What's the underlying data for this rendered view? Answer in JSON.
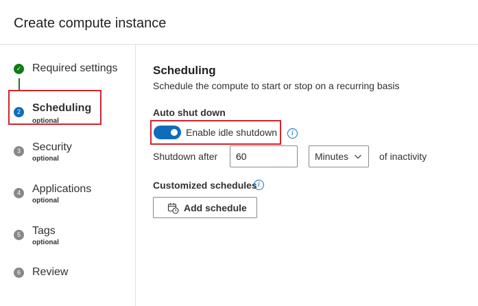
{
  "header": {
    "title": "Create compute instance"
  },
  "steps": [
    {
      "number": "✓",
      "label": "Required settings",
      "sub": "",
      "state": "completed"
    },
    {
      "number": "2",
      "label": "Scheduling",
      "sub": "optional",
      "state": "active"
    },
    {
      "number": "3",
      "label": "Security",
      "sub": "optional",
      "state": "pending"
    },
    {
      "number": "4",
      "label": "Applications",
      "sub": "optional",
      "state": "pending"
    },
    {
      "number": "5",
      "label": "Tags",
      "sub": "optional",
      "state": "pending"
    },
    {
      "number": "6",
      "label": "Review",
      "sub": "",
      "state": "pending"
    }
  ],
  "main": {
    "title": "Scheduling",
    "description": "Schedule the compute to start or stop on a recurring basis",
    "auto_shutdown": {
      "heading": "Auto shut down",
      "toggle_label": "Enable idle shutdown",
      "toggle_on": true,
      "shutdown_after_label": "Shutdown after",
      "shutdown_value": "60",
      "unit_selected": "Minutes",
      "suffix": "of inactivity"
    },
    "custom_schedules": {
      "heading": "Customized schedules",
      "add_button": "Add schedule"
    }
  },
  "colors": {
    "accent": "#0f6cbd",
    "complete": "#107c10",
    "pending": "#8a8886",
    "highlight": "#d1232a"
  },
  "icons": {
    "info": "info-icon",
    "check": "checkmark-icon",
    "calendar": "calendar-clock-icon",
    "chevron": "chevron-down-icon"
  }
}
